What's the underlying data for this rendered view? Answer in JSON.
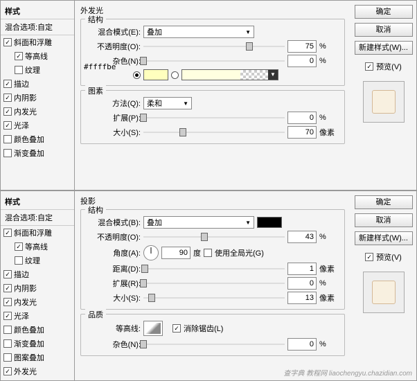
{
  "common": {
    "styles_header": "样式",
    "blend_options": "混合选项:自定",
    "ok": "确定",
    "cancel": "取消",
    "new_style": "新建样式(W)...",
    "preview": "预览(V)"
  },
  "sidebar_items": [
    {
      "label": "斜面和浮雕",
      "checked": true,
      "indent": false
    },
    {
      "label": "等高线",
      "checked": true,
      "indent": true
    },
    {
      "label": "纹理",
      "checked": false,
      "indent": true
    },
    {
      "label": "描边",
      "checked": true,
      "indent": false
    },
    {
      "label": "内阴影",
      "checked": true,
      "indent": false
    },
    {
      "label": "内发光",
      "checked": true,
      "indent": false
    },
    {
      "label": "光泽",
      "checked": true,
      "indent": false
    },
    {
      "label": "颜色叠加",
      "checked": false,
      "indent": false
    },
    {
      "label": "渐变叠加",
      "checked": false,
      "indent": false
    }
  ],
  "sidebar_items_bottom_extra": [
    {
      "label": "图案叠加",
      "checked": false,
      "indent": false
    },
    {
      "label": "外发光",
      "checked": true,
      "indent": false
    }
  ],
  "top": {
    "title": "外发光",
    "struct": "结构",
    "blend_mode_lbl": "混合模式(E):",
    "blend_mode_val": "叠加",
    "opacity_lbl": "不透明度(O):",
    "opacity_val": "75",
    "pct": "%",
    "noise_lbl": "杂色(N):",
    "noise_val": "0",
    "hex": "#ffffbe",
    "elements": "图素",
    "method_lbl": "方法(Q):",
    "method_val": "柔和",
    "spread_lbl": "扩展(P):",
    "spread_val": "0",
    "size_lbl": "大小(S):",
    "size_val": "70",
    "px": "像素"
  },
  "bottom": {
    "title": "投影",
    "struct": "结构",
    "blend_mode_lbl": "混合模式(B):",
    "blend_mode_val": "叠加",
    "opacity_lbl": "不透明度(O):",
    "opacity_val": "43",
    "pct": "%",
    "angle_lbl": "角度(A):",
    "angle_val": "90",
    "deg": "度",
    "global_light": "使用全局光(G)",
    "distance_lbl": "距离(D):",
    "distance_val": "1",
    "px": "像素",
    "spread_lbl": "扩展(R):",
    "spread_val": "0",
    "size_lbl": "大小(S):",
    "size_val": "13",
    "quality": "品质",
    "contour_lbl": "等高线:",
    "antialias": "消除锯齿(L)",
    "noise_lbl": "杂色(N):",
    "noise_val": "0"
  },
  "watermark": "查字典 教程网 liaochengyu.chazidian.com"
}
